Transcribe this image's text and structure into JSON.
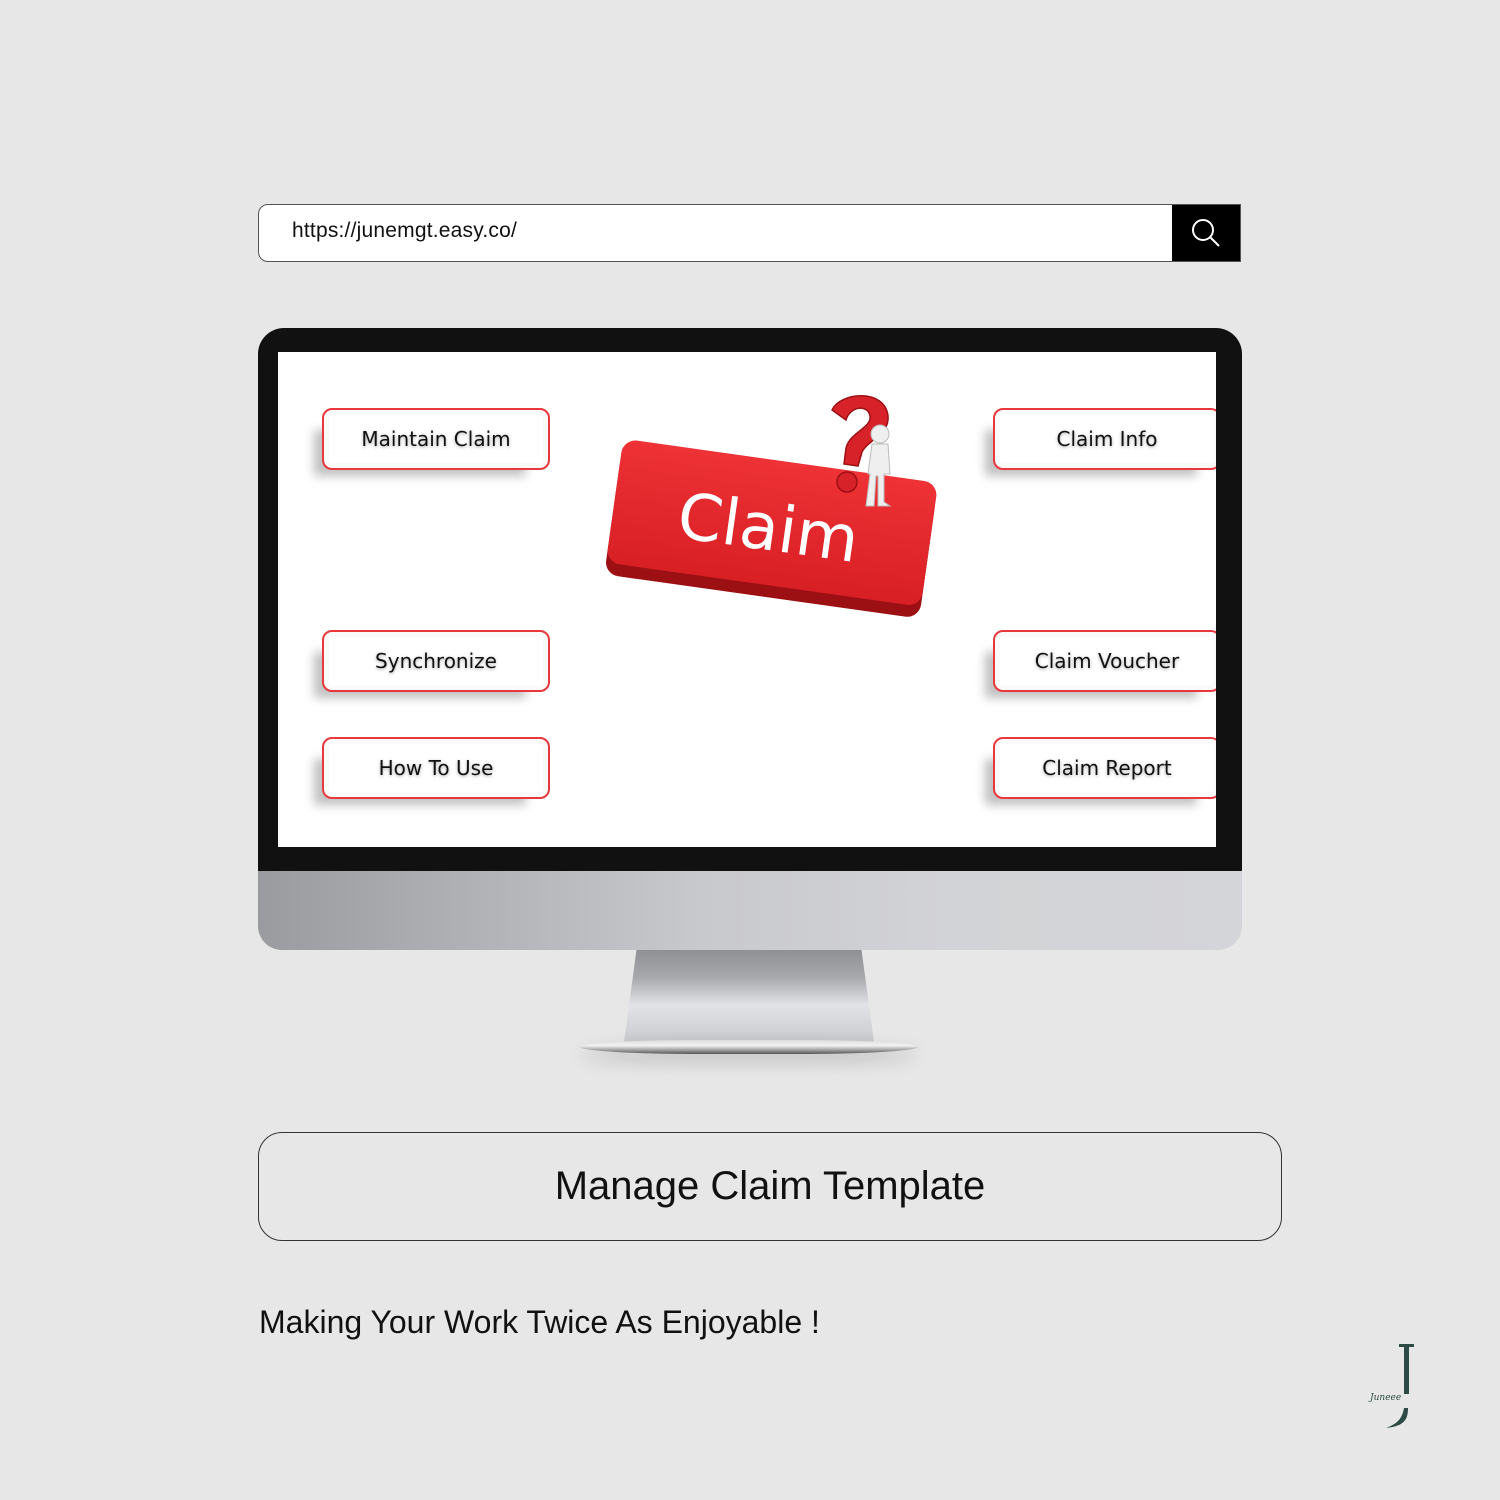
{
  "address_bar": {
    "url": "https://junemgt.easy.co/",
    "search_icon": "search-icon"
  },
  "screen": {
    "hero_label": "Claim",
    "hero_icons": [
      "question-mark-icon",
      "thinking-person-icon"
    ],
    "left_buttons": [
      {
        "label": "Maintain Claim"
      },
      {
        "label": "Synchronize"
      },
      {
        "label": "How To Use"
      }
    ],
    "right_buttons": [
      {
        "label": "Claim Info"
      },
      {
        "label": "Claim Voucher"
      },
      {
        "label": "Claim Report"
      }
    ],
    "colors": {
      "accent_red": "#e8262a",
      "button_border": "#e8383b"
    }
  },
  "caption": {
    "title": "Manage Claim Template",
    "tagline": "Making Your Work Twice As Enjoyable !"
  },
  "brand": {
    "logo_letter": "J",
    "logo_signature": "Juneee",
    "color": "#2d4a44"
  }
}
